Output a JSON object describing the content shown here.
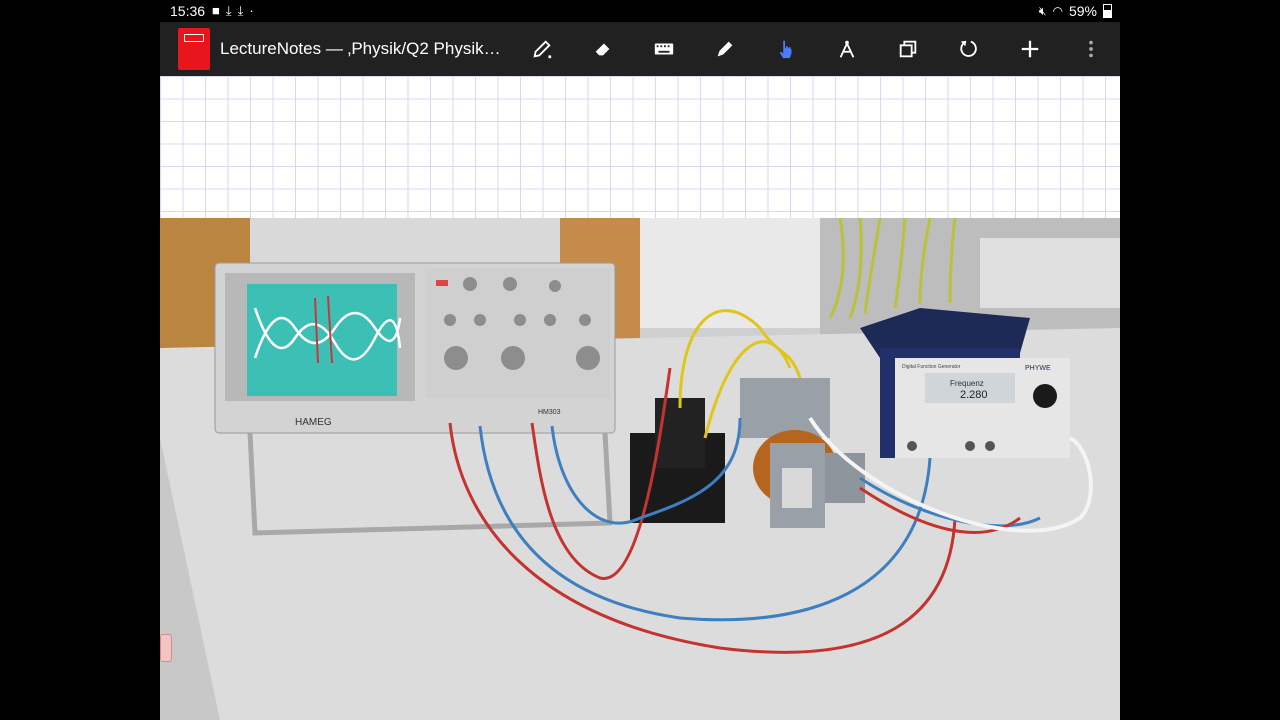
{
  "status_bar": {
    "time": "15:36",
    "notification_icons": [
      "video-icon",
      "download-icon",
      "download-icon",
      "dot"
    ],
    "battery": "59%"
  },
  "app_bar": {
    "title": "LectureNotes — ‚Physik/Q2 Physik…",
    "tools": [
      "pen-icon",
      "eraser-icon",
      "keyboard-icon",
      "marker-icon",
      "hand-pointer-icon",
      "compass-icon",
      "copy-icon",
      "undo-icon",
      "add-icon",
      "more-vert-icon"
    ],
    "active_tool": "hand-pointer-icon",
    "colors": {
      "bar": "#212121",
      "notebook": "#e8161c",
      "active": "#4a7cff"
    }
  },
  "photo": {
    "oscilloscope_brand": "HAMEG",
    "oscilloscope_model": "HM303",
    "generator_brand": "PHYWE",
    "generator_label": "Digital Function Generator",
    "generator_reading": "2.280",
    "generator_mode": "Frequenz"
  }
}
